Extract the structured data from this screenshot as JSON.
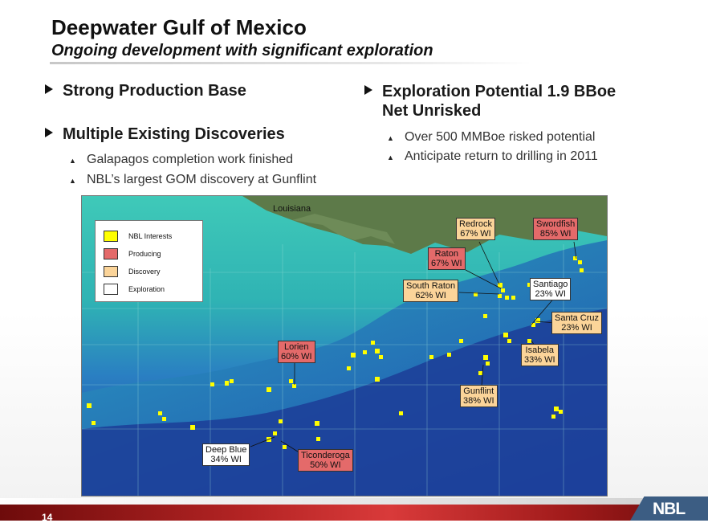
{
  "header": {
    "title": "Deepwater Gulf of Mexico",
    "subtitle": "Ongoing development with significant exploration"
  },
  "left_column": {
    "bullets": [
      {
        "label": "Strong Production Base"
      },
      {
        "label": "Multiple Existing Discoveries"
      }
    ],
    "sub_bullets": [
      "Galapagos completion work finished",
      "NBL’s largest GOM discovery at Gunflint"
    ]
  },
  "right_column": {
    "bullet_line1": "Exploration Potential 1.9 BBoe",
    "bullet_line2": "Net Unrisked",
    "sub_bullets": [
      "Over 500 MMBoe risked potential",
      "Anticipate return to drilling in 2011"
    ]
  },
  "map": {
    "state_label": "Louisiana",
    "legend": [
      {
        "label": "NBL Interests",
        "color": "#ffff00"
      },
      {
        "label": "Producing",
        "color": "#e46a6a"
      },
      {
        "label": "Discovery",
        "color": "#fbd499"
      },
      {
        "label": "Exploration",
        "color": "#ffffff"
      }
    ],
    "fields": [
      {
        "name": "Redrock",
        "wi": "67% WI",
        "status": "discovery"
      },
      {
        "name": "Swordfish",
        "wi": "85% WI",
        "status": "producing"
      },
      {
        "name": "Raton",
        "wi": "67% WI",
        "status": "producing"
      },
      {
        "name": "South Raton",
        "wi": "62% WI",
        "status": "discovery"
      },
      {
        "name": "Santiago",
        "wi": "23% WI",
        "status": "exploration"
      },
      {
        "name": "Santa Cruz",
        "wi": "23% WI",
        "status": "discovery"
      },
      {
        "name": "Isabela",
        "wi": "33% WI",
        "status": "discovery"
      },
      {
        "name": "Lorien",
        "wi": "60% WI",
        "status": "producing"
      },
      {
        "name": "Gunflint",
        "wi": "38% WI",
        "status": "discovery"
      },
      {
        "name": "Deep Blue",
        "wi": "34% WI",
        "status": "exploration"
      },
      {
        "name": "Ticonderoga",
        "wi": "50% WI",
        "status": "producing"
      }
    ]
  },
  "footer": {
    "page_number": "14",
    "logo_text": "NBL"
  },
  "colors": {
    "producing": "#e46a6a",
    "discovery": "#fbd499",
    "exploration": "#ffffff",
    "nbl_interests": "#ffff00",
    "footer_red": "#b42424",
    "logo_blue": "#3c5d83"
  }
}
